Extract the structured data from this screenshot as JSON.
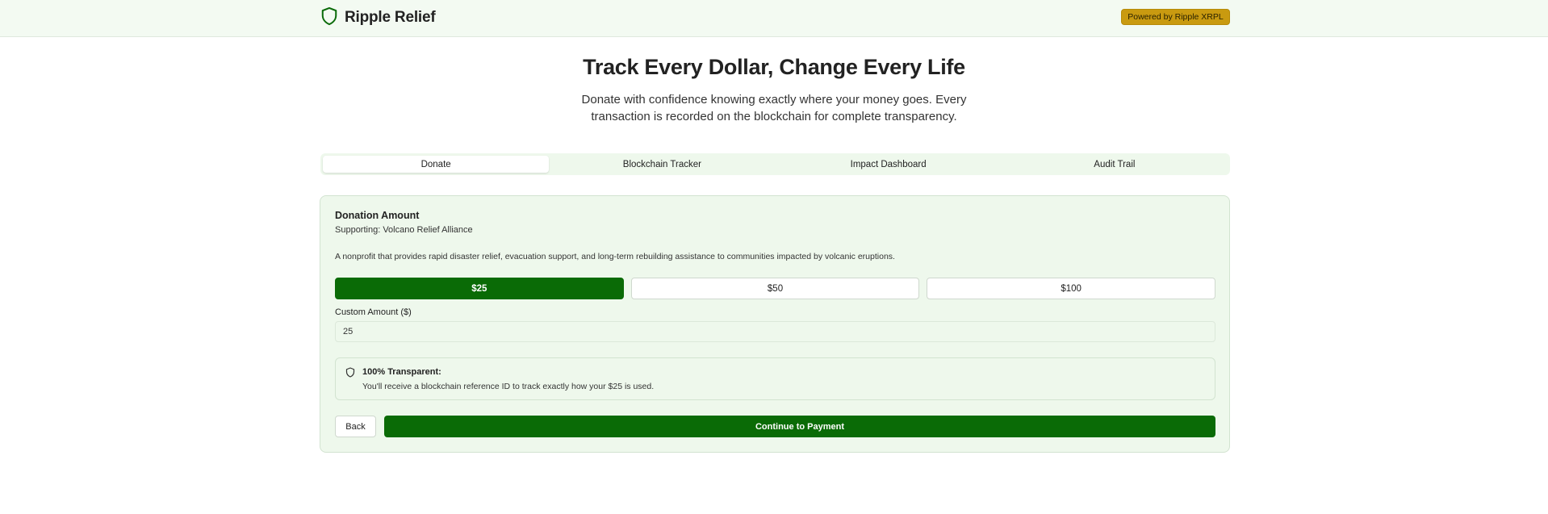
{
  "header": {
    "brand_name": "Ripple Relief",
    "brand_icon": "shield-icon",
    "badge": "Powered by Ripple XRPL"
  },
  "hero": {
    "title": "Track Every Dollar, Change Every Life",
    "subtitle": "Donate with confidence knowing exactly where your money goes. Every transaction is recorded on the blockchain for complete transparency."
  },
  "tabs": [
    {
      "label": "Donate",
      "active": true
    },
    {
      "label": "Blockchain Tracker",
      "active": false
    },
    {
      "label": "Impact Dashboard",
      "active": false
    },
    {
      "label": "Audit Trail",
      "active": false
    }
  ],
  "donation": {
    "title": "Donation Amount",
    "supporting": "Supporting: Volcano Relief Alliance",
    "description": "A nonprofit that provides rapid disaster relief, evacuation support, and long-term rebuilding assistance to communities impacted by volcanic eruptions.",
    "amounts": [
      {
        "label": "$25",
        "selected": true
      },
      {
        "label": "$50",
        "selected": false
      },
      {
        "label": "$100",
        "selected": false
      }
    ],
    "custom_label": "Custom Amount ($)",
    "custom_value": "25",
    "notice": {
      "icon": "shield-icon",
      "title": "100% Transparent:",
      "text": "You'll receive a blockchain reference ID to track exactly how your $25 is used."
    },
    "back_label": "Back",
    "continue_label": "Continue to Payment"
  },
  "colors": {
    "primary_green": "#0a6b06",
    "badge_gold": "#c99a10",
    "surface_green": "#eef8ec"
  }
}
